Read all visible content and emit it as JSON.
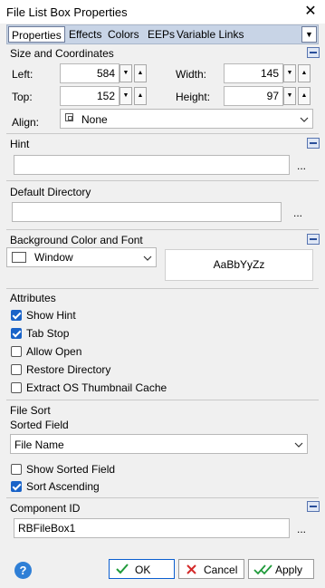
{
  "window": {
    "title": "File List Box Properties",
    "close_glyph": "✕"
  },
  "tabs": [
    {
      "label": "Properties",
      "active": true
    },
    {
      "label": "Effects"
    },
    {
      "label": "Colors"
    },
    {
      "label": "EEPs"
    },
    {
      "label": "Variable Links"
    }
  ],
  "size_section": {
    "title": "Size and Coordinates",
    "left_label": "Left:",
    "left_value": "584",
    "width_label": "Width:",
    "width_value": "145",
    "top_label": "Top:",
    "top_value": "152",
    "height_label": "Height:",
    "height_value": "97",
    "align_label": "Align:",
    "align_value": "None"
  },
  "hint_section": {
    "title": "Hint",
    "value": "",
    "ellipsis": "..."
  },
  "default_dir_section": {
    "title": "Default Directory",
    "value": "",
    "ellipsis": "..."
  },
  "bg_section": {
    "title": "Background Color and Font",
    "color_value": "Window",
    "font_preview": "AaBbYyZz"
  },
  "attributes_section": {
    "title": "Attributes",
    "items": [
      {
        "label": "Show Hint",
        "checked": true
      },
      {
        "label": "Tab Stop",
        "checked": true
      },
      {
        "label": "Allow Open",
        "checked": false
      },
      {
        "label": "Restore Directory",
        "checked": false
      },
      {
        "label": "Extract OS Thumbnail Cache",
        "checked": false
      }
    ]
  },
  "file_sort_section": {
    "title": "File Sort",
    "sorted_field_label": "Sorted Field",
    "sorted_field_value": "File Name",
    "show_sorted_field": {
      "label": "Show Sorted Field",
      "checked": false
    },
    "sort_ascending": {
      "label": "Sort Ascending",
      "checked": true
    }
  },
  "component_id_section": {
    "title": "Component ID",
    "value": "RBFileBox1",
    "ellipsis": "..."
  },
  "footer": {
    "help_glyph": "?",
    "ok_label": "OK",
    "cancel_label": "Cancel",
    "apply_label": "Apply"
  },
  "colors": {
    "tab_bar": "#c8d4e6",
    "checkbox_checked": "#1a63c8",
    "help_icon": "#2f7fd6",
    "ok_check": "#1f9a3a",
    "cancel_x": "#d42a2a"
  }
}
